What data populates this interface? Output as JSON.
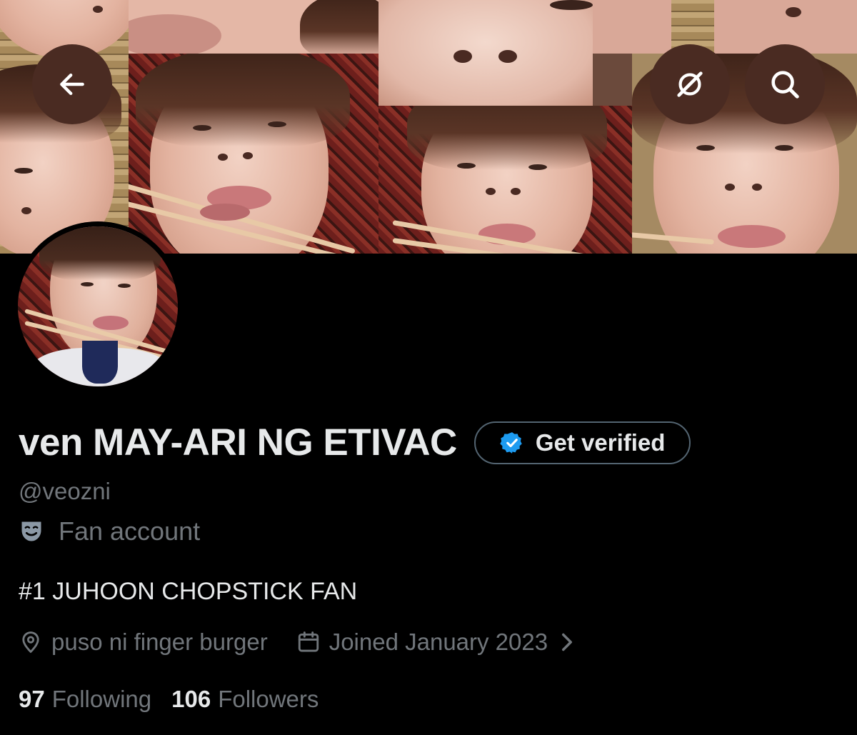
{
  "banner": {
    "description_icons": {
      "back": "arrow-left-icon",
      "grok": "grok-slash-icon",
      "search": "search-icon"
    }
  },
  "profile": {
    "display_name": "ven MAY-ARI NG ETIVAC",
    "verify_button_label": "Get verified",
    "handle": "@veozni",
    "category": "Fan account",
    "bio": "#1 JUHOON CHOPSTICK FAN",
    "location": "puso ni finger burger",
    "joined": "Joined January 2023",
    "following_count": "97",
    "following_label": "Following",
    "followers_count": "106",
    "followers_label": "Followers"
  },
  "colors": {
    "background": "#000000",
    "primary_text": "#e7e9ea",
    "secondary_text": "#71767b",
    "verified_blue": "#1d9bf0",
    "nav_button_bg": "#4a2b22"
  }
}
